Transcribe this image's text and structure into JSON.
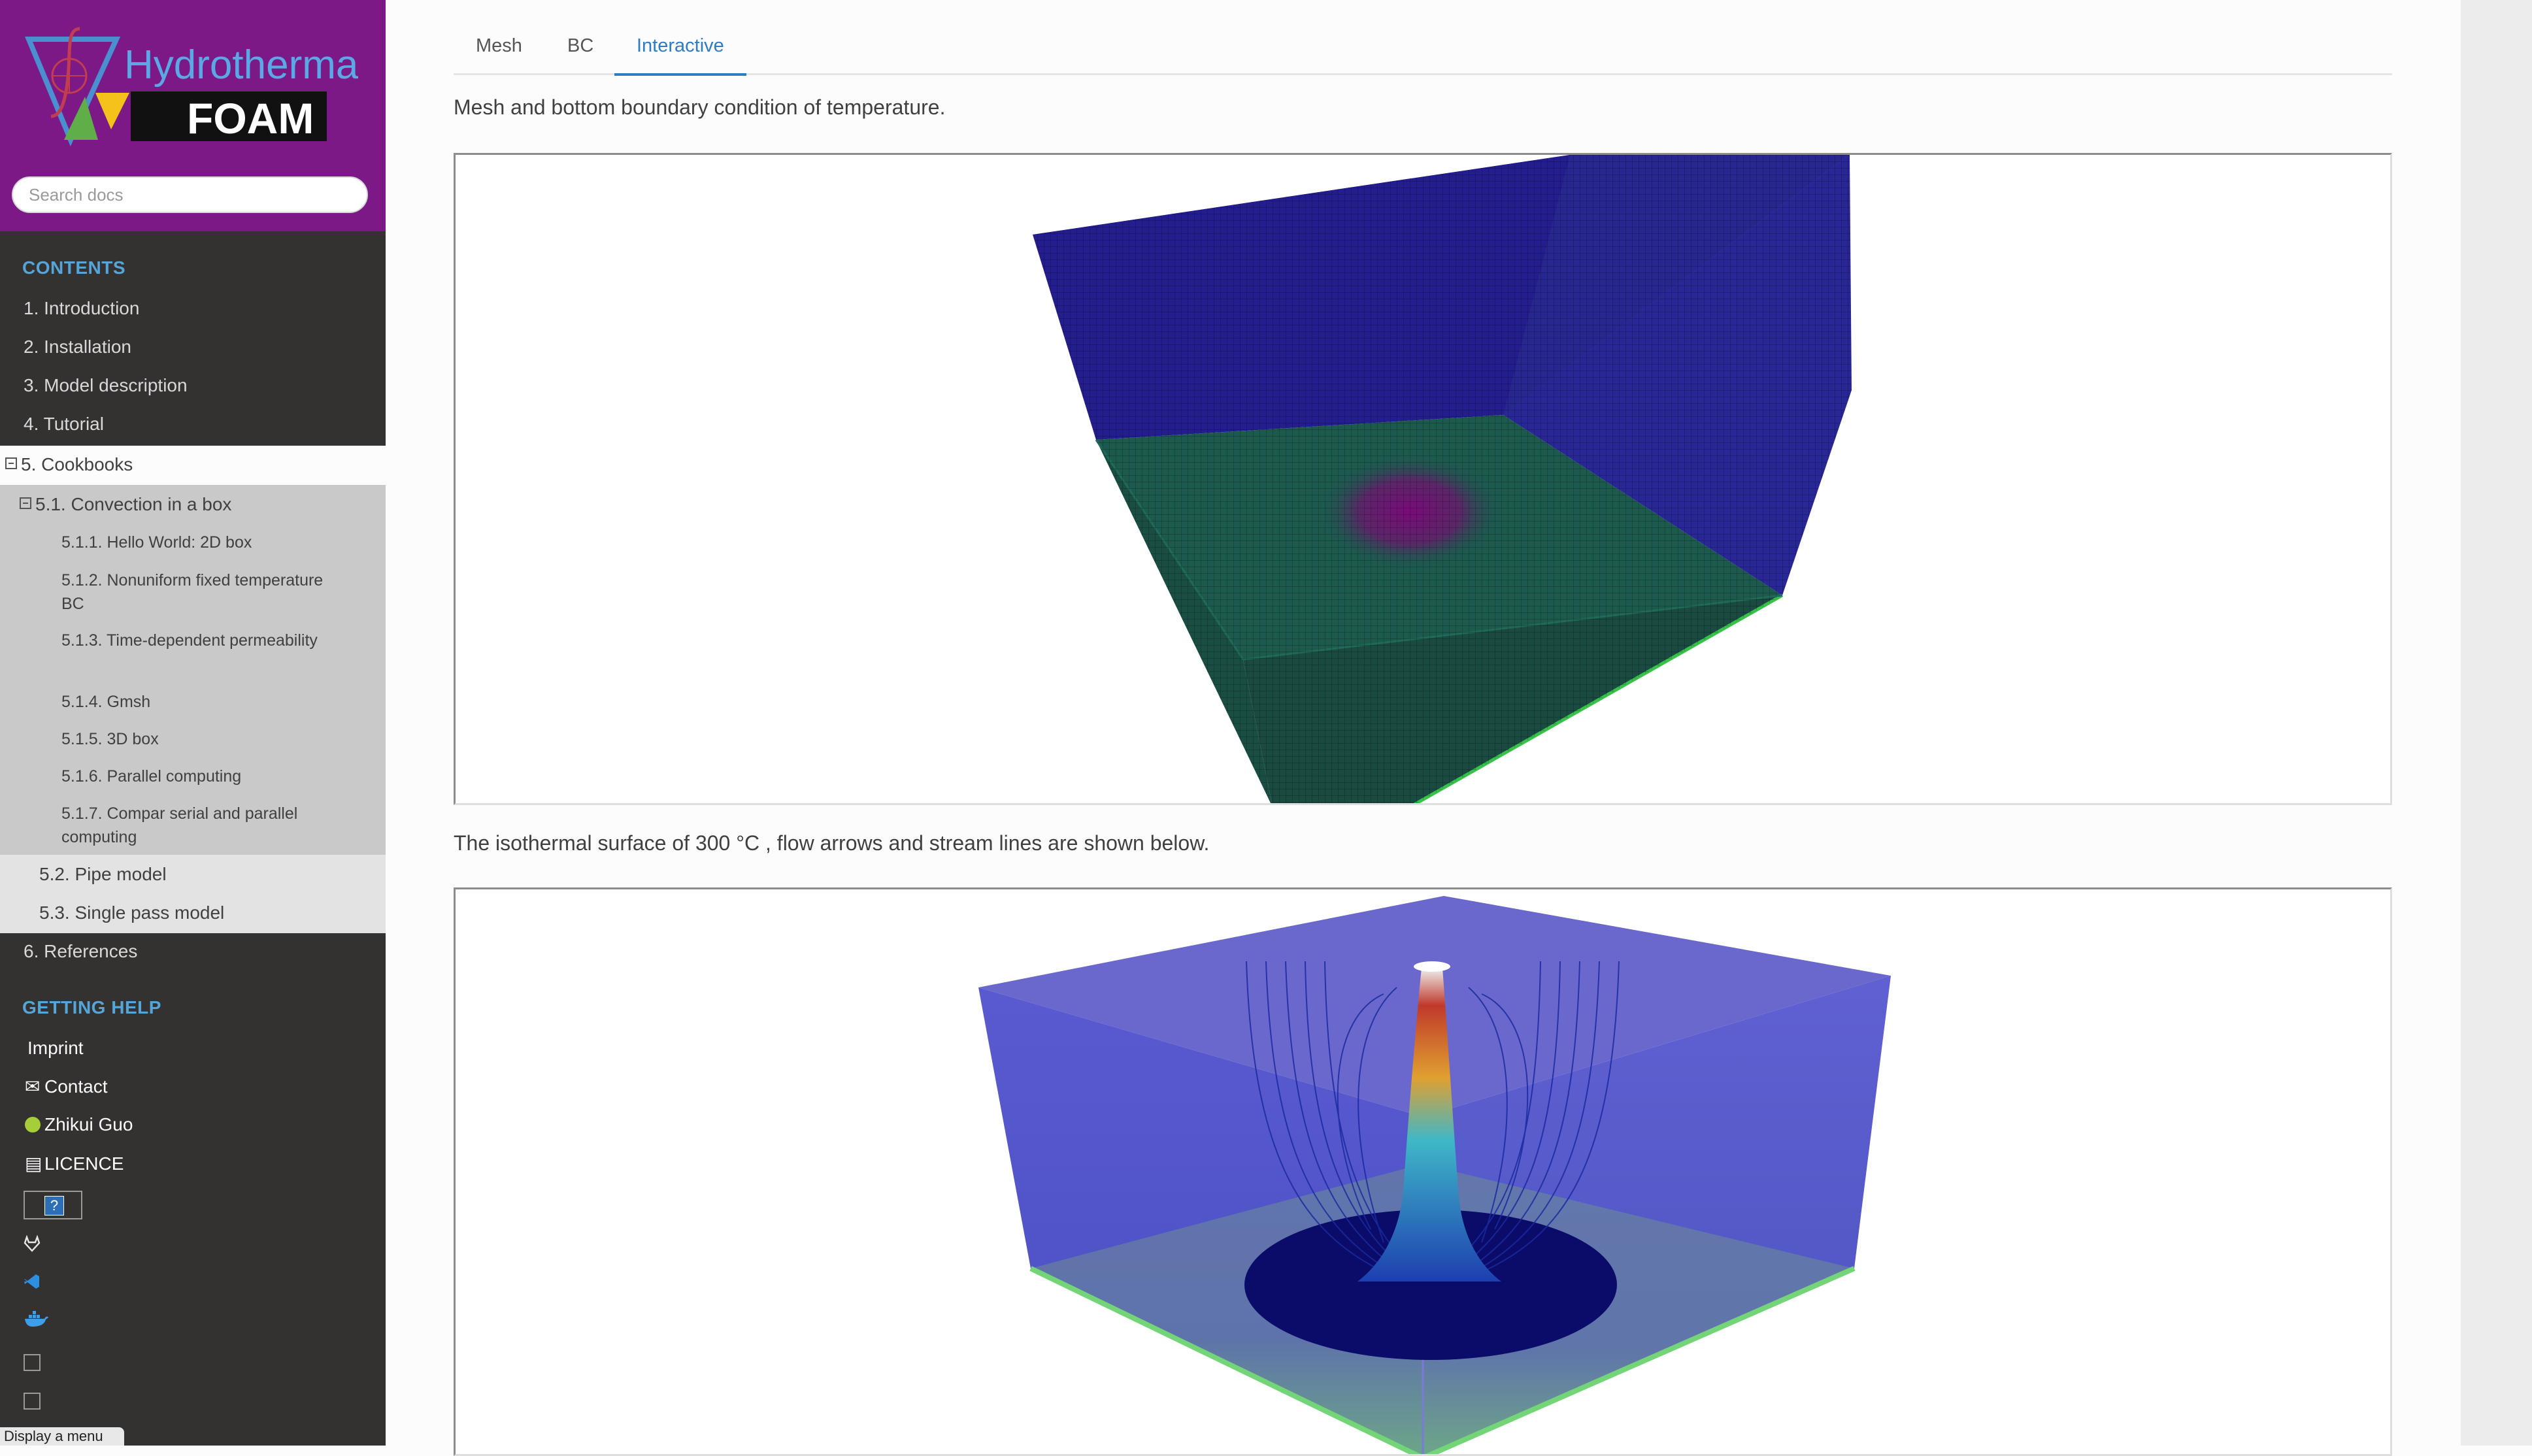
{
  "sidebar": {
    "logo": {
      "text_top": "Hydrothermal",
      "text_bottom": "FOAM"
    },
    "search_placeholder": "Search docs",
    "contents_caption": "CONTENTS",
    "toc": [
      "1. Introduction",
      "2. Installation",
      "3. Model description",
      "4. Tutorial",
      "5. Cookbooks",
      "5.1. Convection in a box",
      "5.1.1. Hello World: 2D box",
      "5.1.2. Nonuniform fixed temperature BC",
      "5.1.3. Time-dependent permeability",
      "5.1.4. Gmsh",
      "5.1.5. 3D box",
      "5.1.6. Parallel computing",
      "5.1.7. Compar serial and parallel computing",
      "5.2. Pipe model",
      "5.3. Single pass model",
      "6. References"
    ],
    "help_caption": "GETTING HELP",
    "help_links": [
      "Imprint",
      "Contact",
      "Zhikui Guo",
      "LICENCE"
    ],
    "tooltip": "Display a menu"
  },
  "main": {
    "tabs": [
      "Mesh",
      "BC",
      "Interactive"
    ],
    "active_tab": "Interactive",
    "para1": "Mesh and bottom boundary condition of temperature.",
    "para2": "The isothermal surface of 300 °C , flow arrows and stream lines are shown below."
  },
  "colors": {
    "sidebar_top": "#7b1a86",
    "sidebar_bg": "#343131",
    "accent": "#2f7cc4",
    "caption": "#55a5d9"
  }
}
